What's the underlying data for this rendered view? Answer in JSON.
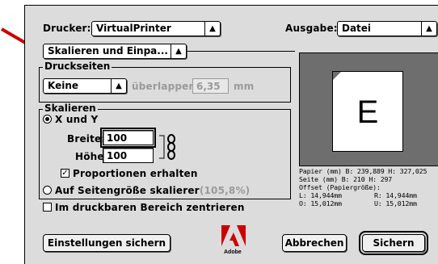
{
  "colors": {
    "dialog_bg": "#dcdcdc",
    "preview_bg": "#6e6e6e",
    "arrow": "#cc0000",
    "disabled_text": "#9a9a9a"
  },
  "header": {
    "printer_label": "Drucker:",
    "printer_value": "VirtualPrinter",
    "output_label": "Ausgabe:",
    "output_value": "Datei"
  },
  "panel_select": {
    "value": "Skalieren und Einpa..."
  },
  "druckseiten": {
    "title": "Druckseiten",
    "mode_value": "Keine",
    "overlap_label": "überlappen",
    "overlap_value": "6,35",
    "overlap_unit": "mm"
  },
  "skalieren": {
    "title": "Skalieren",
    "xy_label": "X und Y",
    "width_label": "Breite:",
    "width_value": "100",
    "height_label": "Höhe:",
    "height_value": "100",
    "proportions_label": "Proportionen erhalten",
    "fit_label": "Auf Seitengröße skalierer",
    "fit_percent": "(105,8%)"
  },
  "center_label": "Im druckbaren Bereich zentrieren",
  "preview": {
    "letter": "E",
    "paper_line": "Papier (mm) B: 239,889  H: 327,025",
    "page_line": "Seite  (mm) B: 210  H: 297",
    "offset_line": "Offset (Papiergröße):",
    "left": "L: 14,944mm",
    "right": "R: 14,944mm",
    "top": "O: 15,012mm",
    "bottom": "U: 15,012mm"
  },
  "buttons": {
    "save_settings": "Einstellungen sichern",
    "cancel": "Abbrechen",
    "save": "Sichern"
  },
  "logo": {
    "text": "Adobe",
    "icon": "adobe-logo-icon"
  }
}
